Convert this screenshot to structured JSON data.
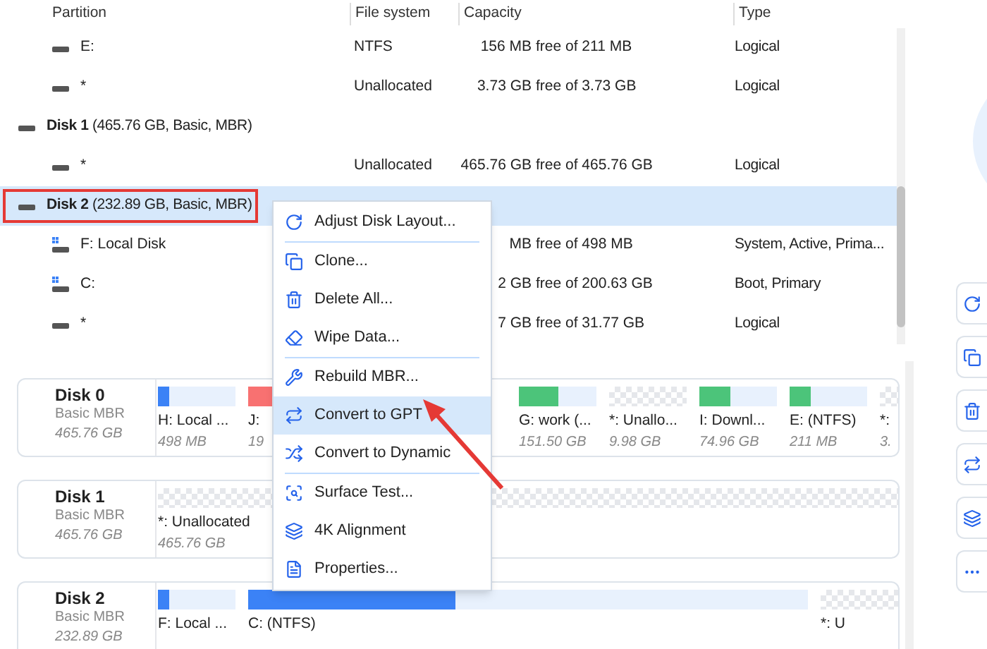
{
  "table": {
    "columns": [
      "Partition",
      "File system",
      "Capacity",
      "Type"
    ],
    "rows": [
      {
        "kind": "partition",
        "name": "E:",
        "fs": "NTFS",
        "size": "156 MB",
        "free": "free of 211 MB",
        "type": "Logical"
      },
      {
        "kind": "partition",
        "name": "*",
        "fs": "Unallocated",
        "size": "3.73 GB",
        "free": "free of 3.73 GB",
        "type": "Logical"
      },
      {
        "kind": "disk",
        "name": "**Disk 1** (465.76 GB, Basic, MBR)",
        "selected": false,
        "outlined": false
      },
      {
        "kind": "partition",
        "name": "*",
        "fs": "Unallocated",
        "size": "465.76 GB",
        "free": "free of 465.76 GB",
        "type": "Logical"
      },
      {
        "kind": "disk",
        "name": "**Disk 2** (232.89 GB, Basic, MBR)",
        "selected": true,
        "outlined": true
      },
      {
        "kind": "system",
        "name": "F: Local Disk",
        "fs": "",
        "size": "MB",
        "free": "free of 498 MB",
        "type": "System, Active, Prima..."
      },
      {
        "kind": "system",
        "name": "C:",
        "fs": "",
        "size": "2 GB",
        "free": "free of 200.63 GB",
        "type": "Boot, Primary"
      },
      {
        "kind": "partition",
        "name": "*",
        "fs": "",
        "size": "7 GB",
        "free": "free of 31.77 GB",
        "type": "Logical"
      }
    ]
  },
  "disks": [
    {
      "name": "Disk 0",
      "style": "Basic MBR",
      "size": "465.76 GB",
      "partitions": [
        {
          "kind": "used",
          "label": "H: Local ...",
          "size": "498 MB",
          "color": "#3b82f6",
          "level": 0.15
        },
        {
          "kind": "used",
          "label": "J:",
          "size": "19",
          "color": "#f87171",
          "level": 0.7
        },
        {
          "kind": "hidden"
        },
        {
          "kind": "hidden"
        },
        {
          "kind": "used",
          "label": "G: work (...",
          "size": "151.50 GB",
          "color": "#4cc47a",
          "level": 0.5
        },
        {
          "kind": "unallocated",
          "label": "*: Unallo...",
          "size": "9.98 GB"
        },
        {
          "kind": "used",
          "label": "I: Downl...",
          "size": "74.96 GB",
          "color": "#4cc47a",
          "level": 0.4
        },
        {
          "kind": "used",
          "label": "E:  (NTFS)",
          "size": "211 MB",
          "color": "#4cc47a",
          "level": 0.28
        },
        {
          "kind": "unallocated",
          "label": "*:",
          "size": "3."
        }
      ]
    },
    {
      "name": "Disk 1",
      "style": "Basic MBR",
      "size": "465.76 GB",
      "partitions": [
        {
          "kind": "unallocated",
          "label": "*: Unallocated",
          "size": "465.76 GB"
        }
      ]
    },
    {
      "name": "Disk 2",
      "style": "Basic MBR",
      "size": "232.89 GB",
      "partitions": [
        {
          "kind": "used",
          "label": "F: Local ...",
          "color": "#3b82f6",
          "level": 0.15
        },
        {
          "kind": "used",
          "label": "C:  (NTFS)",
          "color": "#3b82f6",
          "level": 0.37
        },
        {
          "kind": "unallocated",
          "label": "*: U"
        }
      ]
    }
  ],
  "context_menu": {
    "groups": [
      [
        {
          "label": "Adjust Disk Layout...",
          "selected": false
        }
      ],
      [
        {
          "label": "Clone...",
          "selected": false
        },
        {
          "label": "Delete All...",
          "selected": false
        },
        {
          "label": "Wipe Data...",
          "selected": false
        }
      ],
      [
        {
          "label": "Rebuild MBR...",
          "selected": false
        },
        {
          "label": "Convert to GPT",
          "selected": true
        },
        {
          "label": "Convert to Dynamic",
          "selected": false
        }
      ],
      [
        {
          "label": "Surface Test...",
          "selected": false
        },
        {
          "label": "4K Alignment",
          "selected": false
        },
        {
          "label": "Properties...",
          "selected": false
        }
      ]
    ]
  }
}
